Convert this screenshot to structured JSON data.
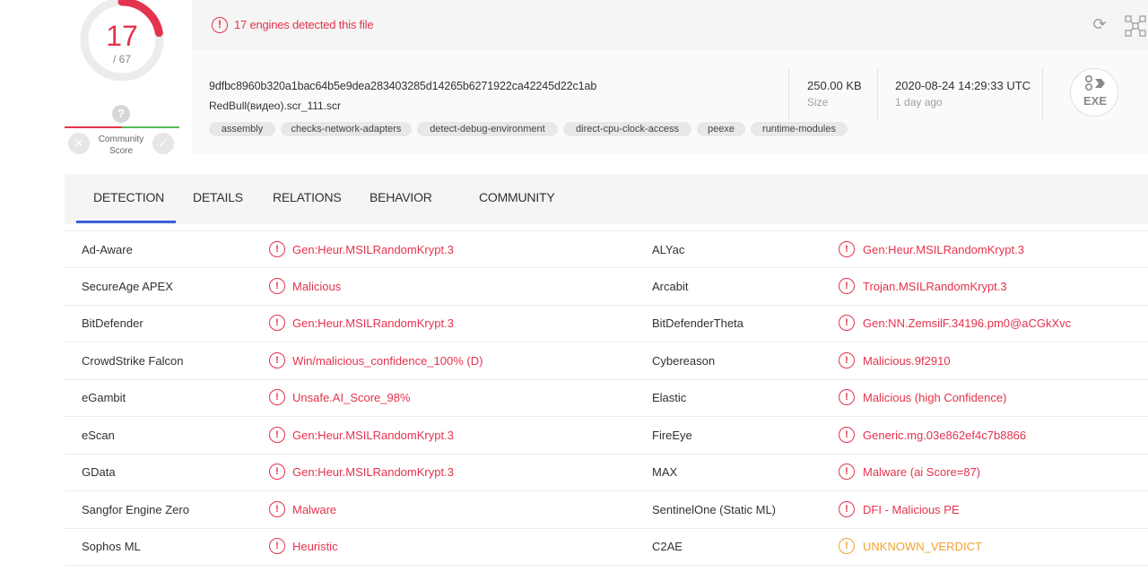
{
  "score": {
    "detected": "17",
    "total": "/ 67"
  },
  "community": {
    "label": "Community Score",
    "question": "?",
    "vote_harmless": "✓",
    "vote_malicious": "✕"
  },
  "alert": {
    "icon": "!",
    "text": "17 engines detected this file"
  },
  "file": {
    "hash": "9dfbc8960b320a1bac64b5e9dea283403285d14265b6271922ca42245d22c1ab",
    "name": "RedBull(видео).scr_111.scr",
    "tags": [
      "assembly",
      "checks-network-adapters",
      "detect-debug-environment",
      "direct-cpu-clock-access",
      "peexe",
      "runtime-modules"
    ],
    "size_value": "250.00 KB",
    "size_label": "Size",
    "date_value": "2020-08-24 14:29:33 UTC",
    "date_label": "1 day ago",
    "type": "EXE"
  },
  "tabs": [
    {
      "label": "DETECTION",
      "active": true
    },
    {
      "label": "DETAILS"
    },
    {
      "label": "RELATIONS"
    },
    {
      "label": "BEHAVIOR"
    },
    {
      "label": "COMMUNITY"
    }
  ],
  "detections": [
    {
      "engine": "Ad-Aware",
      "result": "Gen:Heur.MSILRandomKrypt.3",
      "engine2": "ALYac",
      "result2": "Gen:Heur.MSILRandomKrypt.3"
    },
    {
      "engine": "SecureAge APEX",
      "result": "Malicious",
      "engine2": "Arcabit",
      "result2": "Trojan.MSILRandomKrypt.3"
    },
    {
      "engine": "BitDefender",
      "result": "Gen:Heur.MSILRandomKrypt.3",
      "engine2": "BitDefenderTheta",
      "result2": "Gen:NN.ZemsilF.34196.pm0@aCGkXvc"
    },
    {
      "engine": "CrowdStrike Falcon",
      "result": "Win/malicious_confidence_100% (D)",
      "engine2": "Cybereason",
      "result2": "Malicious.9f2910"
    },
    {
      "engine": "eGambit",
      "result": "Unsafe.AI_Score_98%",
      "engine2": "Elastic",
      "result2": "Malicious (high Confidence)"
    },
    {
      "engine": "eScan",
      "result": "Gen:Heur.MSILRandomKrypt.3",
      "engine2": "FireEye",
      "result2": "Generic.mg.03e862ef4c7b8866"
    },
    {
      "engine": "GData",
      "result": "Gen:Heur.MSILRandomKrypt.3",
      "engine2": "MAX",
      "result2": "Malware (ai Score=87)"
    },
    {
      "engine": "Sangfor Engine Zero",
      "result": "Malware",
      "engine2": "SentinelOne (Static ML)",
      "result2": "DFI - Malicious PE"
    },
    {
      "engine": "Sophos ML",
      "result": "Heuristic",
      "engine2": "C2AE",
      "result2": "UNKNOWN_VERDICT",
      "result2_status": "unknown"
    }
  ],
  "colors": {
    "malicious": "#e4334c",
    "unknown": "#f0a330",
    "accent": "#3b61d8",
    "harmless": "#5cb85c"
  },
  "icons": {
    "alert": "alert-circle-icon",
    "reload": "reload-icon",
    "graph": "graph-icon",
    "file_type": "exe-file-icon"
  }
}
